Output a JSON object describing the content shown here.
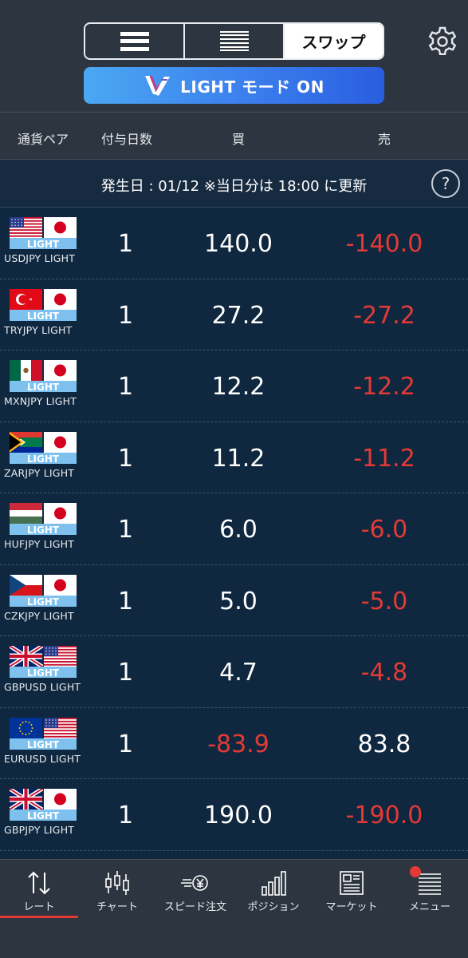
{
  "header": {
    "segments": [
      "",
      "",
      "スワップ"
    ],
    "light_mode_label": "LIGHT モード ON"
  },
  "columns": {
    "pair": "通貨ペア",
    "days": "付与日数",
    "buy": "買",
    "sell": "売"
  },
  "notice": {
    "text": "発生日 : 01/12 ※当日分は 18:00 に更新",
    "help": "?"
  },
  "rows": [
    {
      "name": "USDJPY LIGHT",
      "days": "1",
      "buy": "140.0",
      "sell": "-140.0",
      "flag_left": "us",
      "flag_right": "jp",
      "flag_badge": "LIGHT",
      "buy_color": "white",
      "sell_color": "red"
    },
    {
      "name": "TRYJPY LIGHT",
      "days": "1",
      "buy": "27.2",
      "sell": "-27.2",
      "flag_left": "tr",
      "flag_right": "jp",
      "flag_badge": "LIGHT",
      "buy_color": "white",
      "sell_color": "red"
    },
    {
      "name": "MXNJPY LIGHT",
      "days": "1",
      "buy": "12.2",
      "sell": "-12.2",
      "flag_left": "mx",
      "flag_right": "jp",
      "flag_badge": "LIGHT",
      "buy_color": "white",
      "sell_color": "red"
    },
    {
      "name": "ZARJPY LIGHT",
      "days": "1",
      "buy": "11.2",
      "sell": "-11.2",
      "flag_left": "za",
      "flag_right": "jp",
      "flag_badge": "LIGHT",
      "buy_color": "white",
      "sell_color": "red"
    },
    {
      "name": "HUFJPY LIGHT",
      "days": "1",
      "buy": "6.0",
      "sell": "-6.0",
      "flag_left": "hu",
      "flag_right": "jp",
      "flag_badge": "LIGHT",
      "buy_color": "white",
      "sell_color": "red"
    },
    {
      "name": "CZKJPY LIGHT",
      "days": "1",
      "buy": "5.0",
      "sell": "-5.0",
      "flag_left": "cz",
      "flag_right": "jp",
      "flag_badge": "LIGHT",
      "buy_color": "white",
      "sell_color": "red"
    },
    {
      "name": "GBPUSD LIGHT",
      "days": "1",
      "buy": "4.7",
      "sell": "-4.8",
      "flag_left": "gb",
      "flag_right": "us",
      "flag_badge": "LIGHT",
      "buy_color": "white",
      "sell_color": "red"
    },
    {
      "name": "EURUSD LIGHT",
      "days": "1",
      "buy": "-83.9",
      "sell": "83.8",
      "flag_left": "eu",
      "flag_right": "us",
      "flag_badge": "LIGHT",
      "buy_color": "red",
      "sell_color": "white"
    },
    {
      "name": "GBPJPY LIGHT",
      "days": "1",
      "buy": "190.0",
      "sell": "-190.0",
      "flag_left": "gb",
      "flag_right": "jp",
      "flag_badge": "LIGHT",
      "buy_color": "white",
      "sell_color": "red"
    }
  ],
  "nav": [
    {
      "label": "レート",
      "icon": "rate-arrows-icon"
    },
    {
      "label": "チャート",
      "icon": "candlestick-icon"
    },
    {
      "label": "スピード注文",
      "icon": "speed-yen-icon"
    },
    {
      "label": "ポジション",
      "icon": "bar-chart-icon"
    },
    {
      "label": "マーケット",
      "icon": "newspaper-icon"
    },
    {
      "label": "メニュー",
      "icon": "menu-list-icon"
    }
  ],
  "colors": {
    "background": "#2d3640",
    "list_background": "#10283f",
    "negative": "#e43a36",
    "accent_blue": "#3d82ee"
  }
}
